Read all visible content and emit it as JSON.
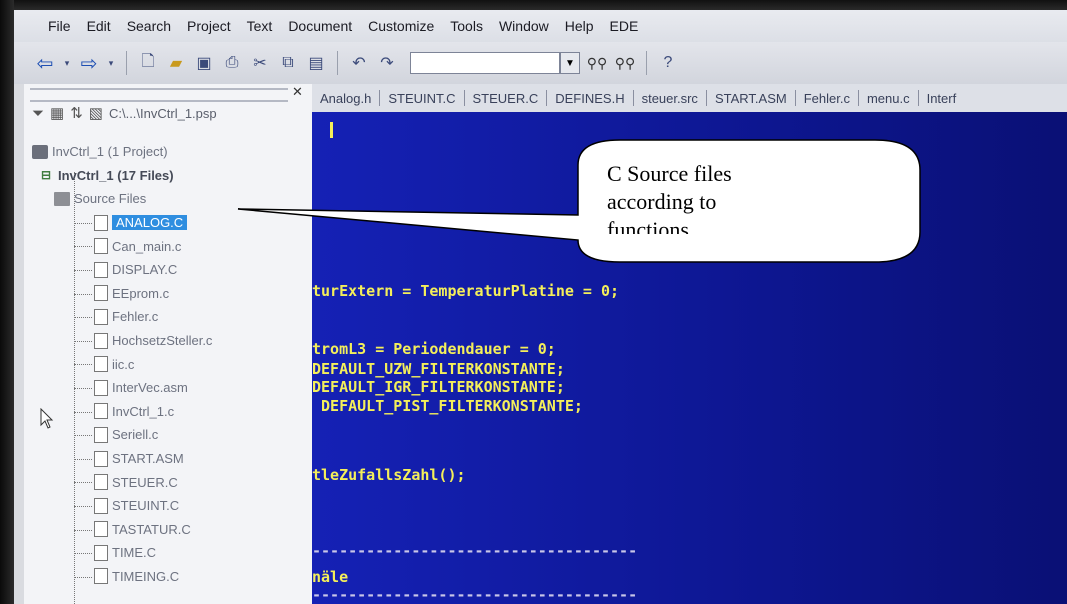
{
  "menubar": {
    "items": [
      "File",
      "Edit",
      "Search",
      "Project",
      "Text",
      "Document",
      "Customize",
      "Tools",
      "Window",
      "Help",
      "EDE"
    ]
  },
  "toolbar": {
    "icons": [
      "back-arrow-icon",
      "forward-arrow-icon",
      "new-file-icon",
      "open-folder-icon",
      "save-icon",
      "print-icon",
      "cut-icon",
      "copy-icon",
      "paste-icon",
      "undo-icon",
      "redo-icon",
      "find-icon",
      "find-next-icon",
      "help-icon"
    ]
  },
  "project_panel": {
    "path": "C:\\...\\InvCtrl_1.psp",
    "tree": [
      {
        "label": "InvCtrl_1 (1 Project)",
        "kind": "project"
      },
      {
        "label": "InvCtrl_1 (17 Files)",
        "kind": "files"
      },
      {
        "label": "Source Files",
        "kind": "folder"
      },
      {
        "label": "ANALOG.C",
        "kind": "file",
        "selected": true
      },
      {
        "label": "Can_main.c",
        "kind": "file"
      },
      {
        "label": "DISPLAY.C",
        "kind": "file"
      },
      {
        "label": "EEprom.c",
        "kind": "file"
      },
      {
        "label": "Fehler.c",
        "kind": "file"
      },
      {
        "label": "HochsetzSteller.c",
        "kind": "file"
      },
      {
        "label": "iic.c",
        "kind": "file"
      },
      {
        "label": "InterVec.asm",
        "kind": "file"
      },
      {
        "label": "InvCtrl_1.c",
        "kind": "file"
      },
      {
        "label": "Seriell.c",
        "kind": "file"
      },
      {
        "label": "START.ASM",
        "kind": "file"
      },
      {
        "label": "STEUER.C",
        "kind": "file"
      },
      {
        "label": "STEUINT.C",
        "kind": "file"
      },
      {
        "label": "TASTATUR.C",
        "kind": "file"
      },
      {
        "label": "TIME.C",
        "kind": "file"
      },
      {
        "label": "TIMEING.C",
        "kind": "file"
      }
    ]
  },
  "tabs": [
    "Analog.h",
    "STEUINT.C",
    "STEUER.C",
    "DEFINES.H",
    "steuer.src",
    "START.ASM",
    "Fehler.c",
    "menu.c",
    "Interf"
  ],
  "editor": {
    "lines": [
      "turExtern = TemperaturPlatine = 0;",
      "tromL3 = Periodendauer = 0;",
      "DEFAULT_UZW_FILTERKONSTANTE;",
      "DEFAULT_IGR_FILTERKONSTANTE;",
      " DEFAULT_PIST_FILTERKONSTANTE;",
      "tleZufallsZahl();",
      "------------------------------------",
      "näle",
      "------------------------------------"
    ]
  },
  "callout": {
    "line1": "C Source files",
    "line2": "according to",
    "line3": "functions"
  },
  "colors": {
    "editor_bg": "#0d1690",
    "code_text": "#f4ef5a",
    "selection": "#2f8ee0"
  }
}
